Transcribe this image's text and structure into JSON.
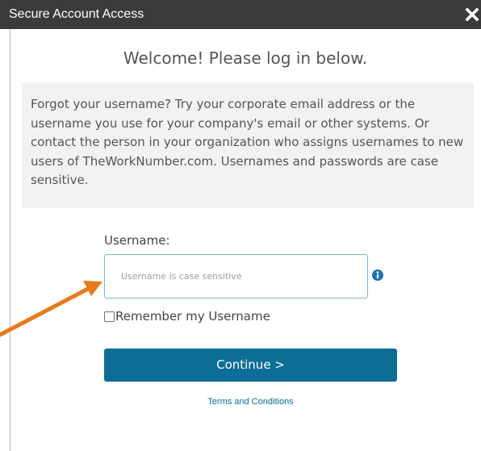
{
  "window": {
    "title": "Secure Account Access",
    "close_icon": "close-icon"
  },
  "login": {
    "heading": "Welcome! Please log in below.",
    "info_text": "Forgot your username? Try your corporate email address or the username you use for your company's email or other systems. Or contact the person in your organization who assigns usernames to new users of TheWorkNumber.com. Usernames and passwords are case sensitive.",
    "username_label": "Username:",
    "username_value": "",
    "username_placeholder": "Username is case sensitive",
    "info_icon": "info-icon",
    "remember_label": "Remember my Username",
    "remember_checked": false,
    "continue_label": "Continue >",
    "terms_link": "Terms and Conditions"
  },
  "annotation": {
    "arrow_icon": "arrow-icon",
    "arrow_color": "#e9791a"
  },
  "colors": {
    "titlebar_bg": "#3b3b3b",
    "panel_bg": "#f2f2f2",
    "button_bg": "#0c6d96",
    "link": "#0c6d96",
    "input_border": "#7fb7da",
    "info_icon": "#1a73b5"
  }
}
